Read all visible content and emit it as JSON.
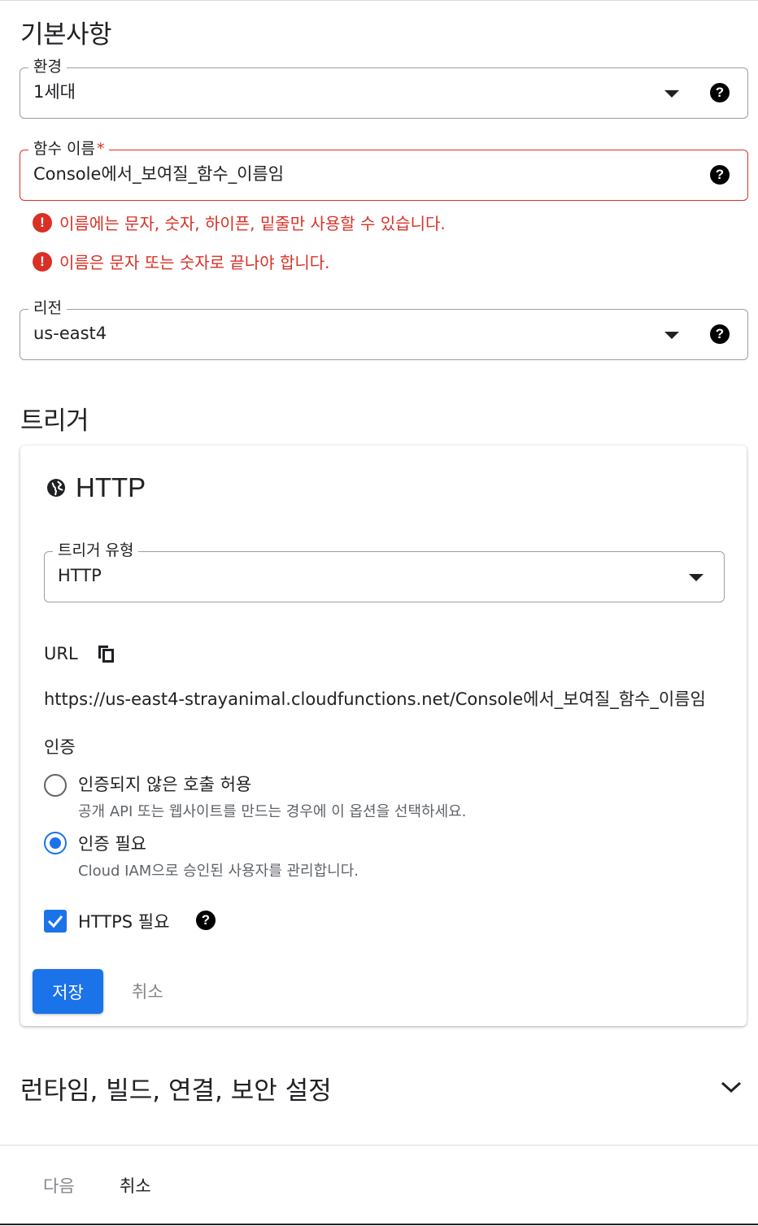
{
  "basics": {
    "heading": "기본사항",
    "environment": {
      "label": "환경",
      "value": "1세대"
    },
    "function_name": {
      "label": "함수 이름",
      "required_mark": "*",
      "value": "Console에서_보여질_함수_이름임",
      "errors": [
        "이름에는 문자, 숫자, 하이픈, 밑줄만 사용할 수 있습니다.",
        "이름은 문자 또는 숫자로 끝나야 합니다."
      ]
    },
    "region": {
      "label": "리전",
      "value": "us-east4"
    }
  },
  "trigger": {
    "heading": "트리거",
    "card_title": "HTTP",
    "trigger_type": {
      "label": "트리거 유형",
      "value": "HTTP"
    },
    "url_label": "URL",
    "url": "https://us-east4-strayanimal.cloudfunctions.net/Console에서_보여질_함수_이름임",
    "auth_label": "인증",
    "auth_options": [
      {
        "title": "인증되지 않은 호출 허용",
        "subtitle": "공개 API 또는 웹사이트를 만드는 경우에 이 옵션을 선택하세요.",
        "selected": false
      },
      {
        "title": "인증 필요",
        "subtitle": "Cloud IAM으로 승인된 사용자를 관리합니다.",
        "selected": true
      }
    ],
    "https_required": {
      "label": "HTTPS 필요",
      "checked": true
    },
    "save_label": "저장",
    "cancel_label": "취소"
  },
  "advanced": {
    "title": "런타임, 빌드, 연결, 보안 설정"
  },
  "footer": {
    "next_label": "다음",
    "cancel_label": "취소"
  },
  "icons": {
    "help": "help-icon",
    "error": "error-icon",
    "dropdown": "caret-down-icon",
    "globe": "globe-icon",
    "copy": "copy-icon",
    "expand": "chevron-down-icon"
  },
  "colors": {
    "accent": "#1a73e8",
    "error": "#d93025",
    "text": "#202124",
    "muted": "#5f6368"
  }
}
